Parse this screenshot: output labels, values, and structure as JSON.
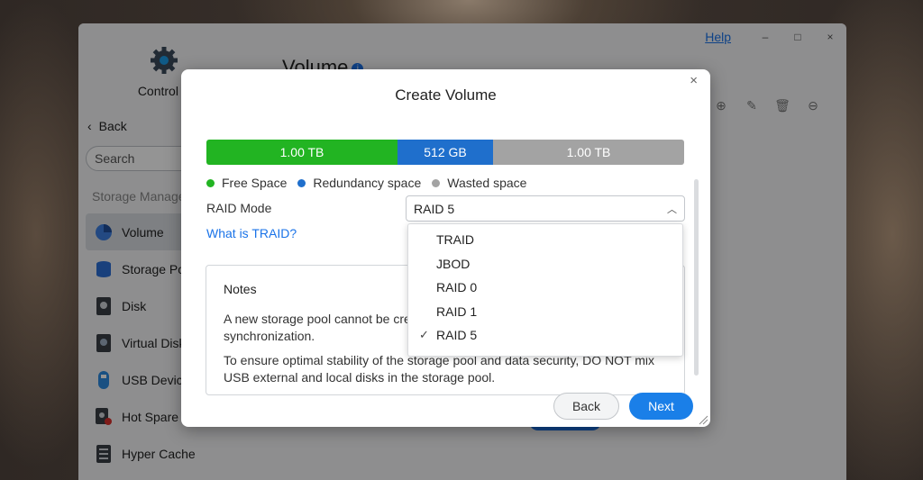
{
  "window": {
    "help_label": "Help",
    "minimize": "–",
    "maximize": "□",
    "close": "×"
  },
  "sidebar": {
    "control_panel_label": "Control P",
    "back_label": "Back",
    "search_placeholder": "Search",
    "section_label": "Storage Manage",
    "items": [
      {
        "label": "Volume",
        "icon": "pie-chart-icon",
        "active": true
      },
      {
        "label": "Storage Po",
        "icon": "database-icon"
      },
      {
        "label": "Disk",
        "icon": "hard-disk-icon"
      },
      {
        "label": "Virtual Disk",
        "icon": "virtual-disk-icon"
      },
      {
        "label": "USB Device",
        "icon": "usb-icon"
      },
      {
        "label": "Hot Spare",
        "icon": "hot-spare-icon"
      },
      {
        "label": "Hyper Cache",
        "icon": "cache-icon"
      }
    ]
  },
  "main": {
    "title": "Volume",
    "info_icon": "i"
  },
  "dialog": {
    "title": "Create Volume",
    "close_label": "×",
    "capacity": [
      {
        "label": "1.00 TB",
        "color": "#22b422",
        "fraction": 0.4
      },
      {
        "label": "512 GB",
        "color": "#1f6fcc",
        "fraction": 0.2
      },
      {
        "label": "1.00 TB",
        "color": "#a3a3a3",
        "fraction": 0.4
      }
    ],
    "legend": [
      {
        "label": "Free Space",
        "color": "#22b422"
      },
      {
        "label": "Redundancy space",
        "color": "#1f6fcc"
      },
      {
        "label": "Wasted space",
        "color": "#a3a3a3"
      }
    ],
    "raid_mode_label": "RAID Mode",
    "raid_selected": "RAID 5",
    "what_is_traid": "What is TRAID?",
    "raid_options": [
      "TRAID",
      "JBOD",
      "RAID 0",
      "RAID 1",
      "RAID 5"
    ],
    "notes_title": "Notes",
    "notes_p1": "A new storage pool cannot be crea",
    "notes_p1b": "synchronization.",
    "notes_p2": "To ensure optimal stability of the storage pool and data security, DO NOT mix USB external and local disks in the storage pool.",
    "back_button": "Back",
    "next_button": "Next"
  }
}
